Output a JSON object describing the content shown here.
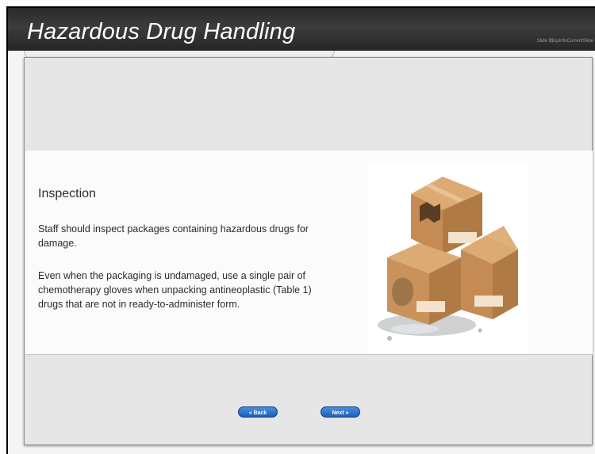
{
  "header": {
    "title": "Hazardous Drug Handling",
    "slide_info": "Slide $$cpInfoCurrentSlide"
  },
  "content": {
    "heading": "Inspection",
    "paragraph1": "Staff should inspect packages containing hazardous drugs for damage.",
    "paragraph2": "Even when the packaging is undamaged, use a single pair of chemotherapy gloves when unpacking antineoplastic (Table 1) drugs that are not in ready-to-administer form."
  },
  "image": {
    "icon": "damaged-boxes-illustration"
  },
  "nav": {
    "back_label": "« Back",
    "next_label": "Next »"
  },
  "colors": {
    "header_bg": "#2f2f2f",
    "button_blue": "#2a6fc9",
    "box_brown": "#c9925a"
  }
}
